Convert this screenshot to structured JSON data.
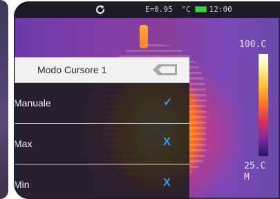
{
  "status_bar": {
    "emissivity": "E=0.95",
    "unit": "°C",
    "time": "12:00",
    "battery_color": "#37d24a"
  },
  "palette_scale": {
    "max_label": "100.C",
    "min_label": "25.C",
    "mode_label": "M"
  },
  "cursor_menu": {
    "title": "Modo Cursore 1",
    "items": [
      {
        "label": "Manuale",
        "mark": "✓",
        "state": "selected"
      },
      {
        "label": "Max",
        "mark": "X",
        "state": "unselected"
      },
      {
        "label": "Min",
        "mark": "X",
        "state": "unselected"
      }
    ]
  },
  "colors": {
    "accent": "#2ea0e6",
    "menu_header_bg": "#f2f2f2",
    "menu_row_bg": "#1e1c1e"
  }
}
